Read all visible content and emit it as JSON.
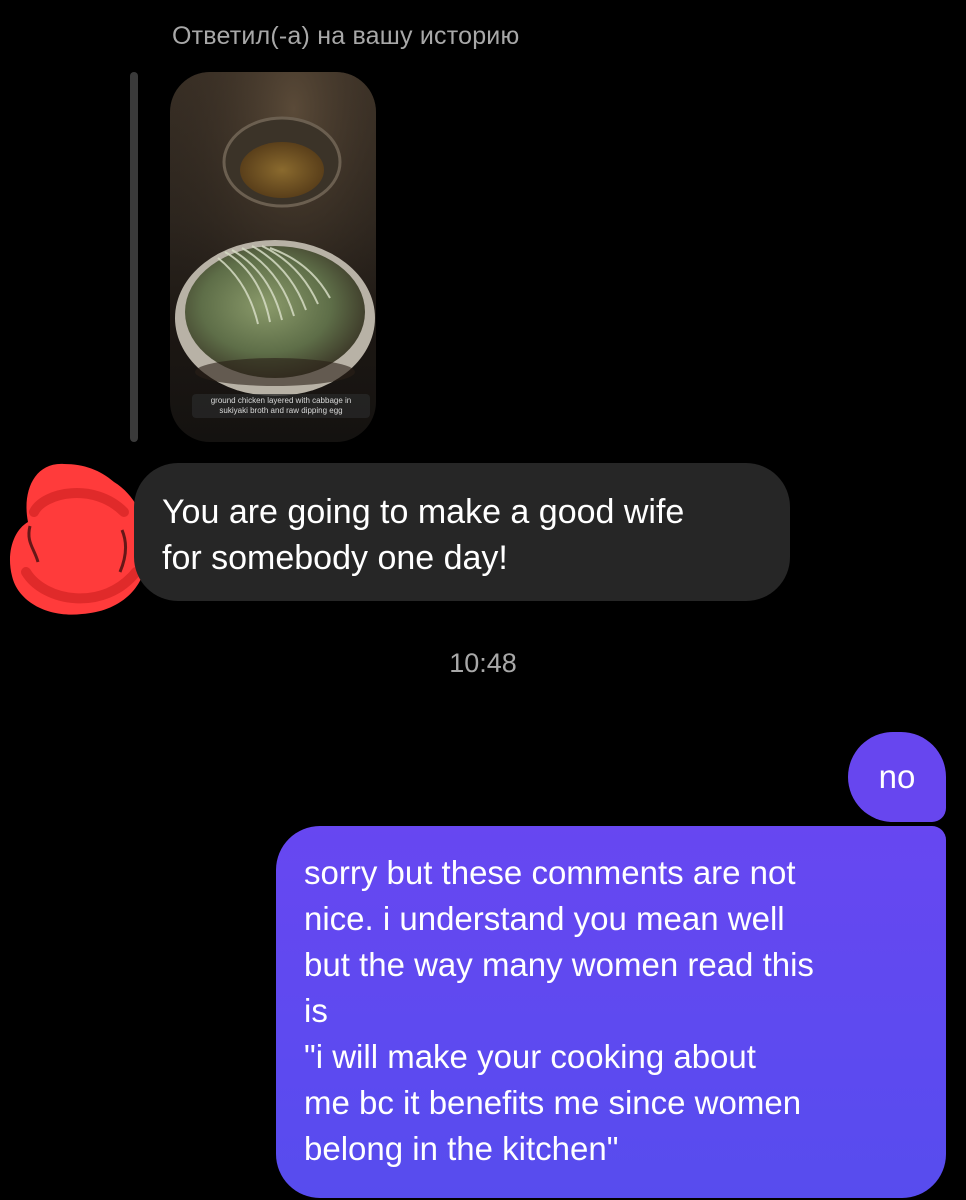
{
  "reply_context": {
    "label": "Ответил(-а) на вашу историю",
    "story_caption": "ground chicken layered with cabbage in sukiyaki broth and raw dipping egg"
  },
  "messages": {
    "incoming": {
      "lines": [
        "You are going to make a good wife",
        "for somebody one day!"
      ]
    },
    "timestamp": "10:48",
    "outgoing_short": "no",
    "outgoing_long": {
      "lines": [
        "sorry but these comments are not",
        "nice. i understand you mean well",
        "but the way many women read this",
        "is",
        "\"i will make your cooking about",
        "me bc it benefits me since women",
        "belong in the kitchen\""
      ]
    }
  },
  "colors": {
    "background": "#000000",
    "incoming_bubble": "#262626",
    "outgoing_bubble": "#6746ef",
    "redaction": "#ff3b3b",
    "muted_text": "#a8a8a8"
  },
  "icons": {
    "redacted_avatar": "avatar-redacted-scribble"
  }
}
